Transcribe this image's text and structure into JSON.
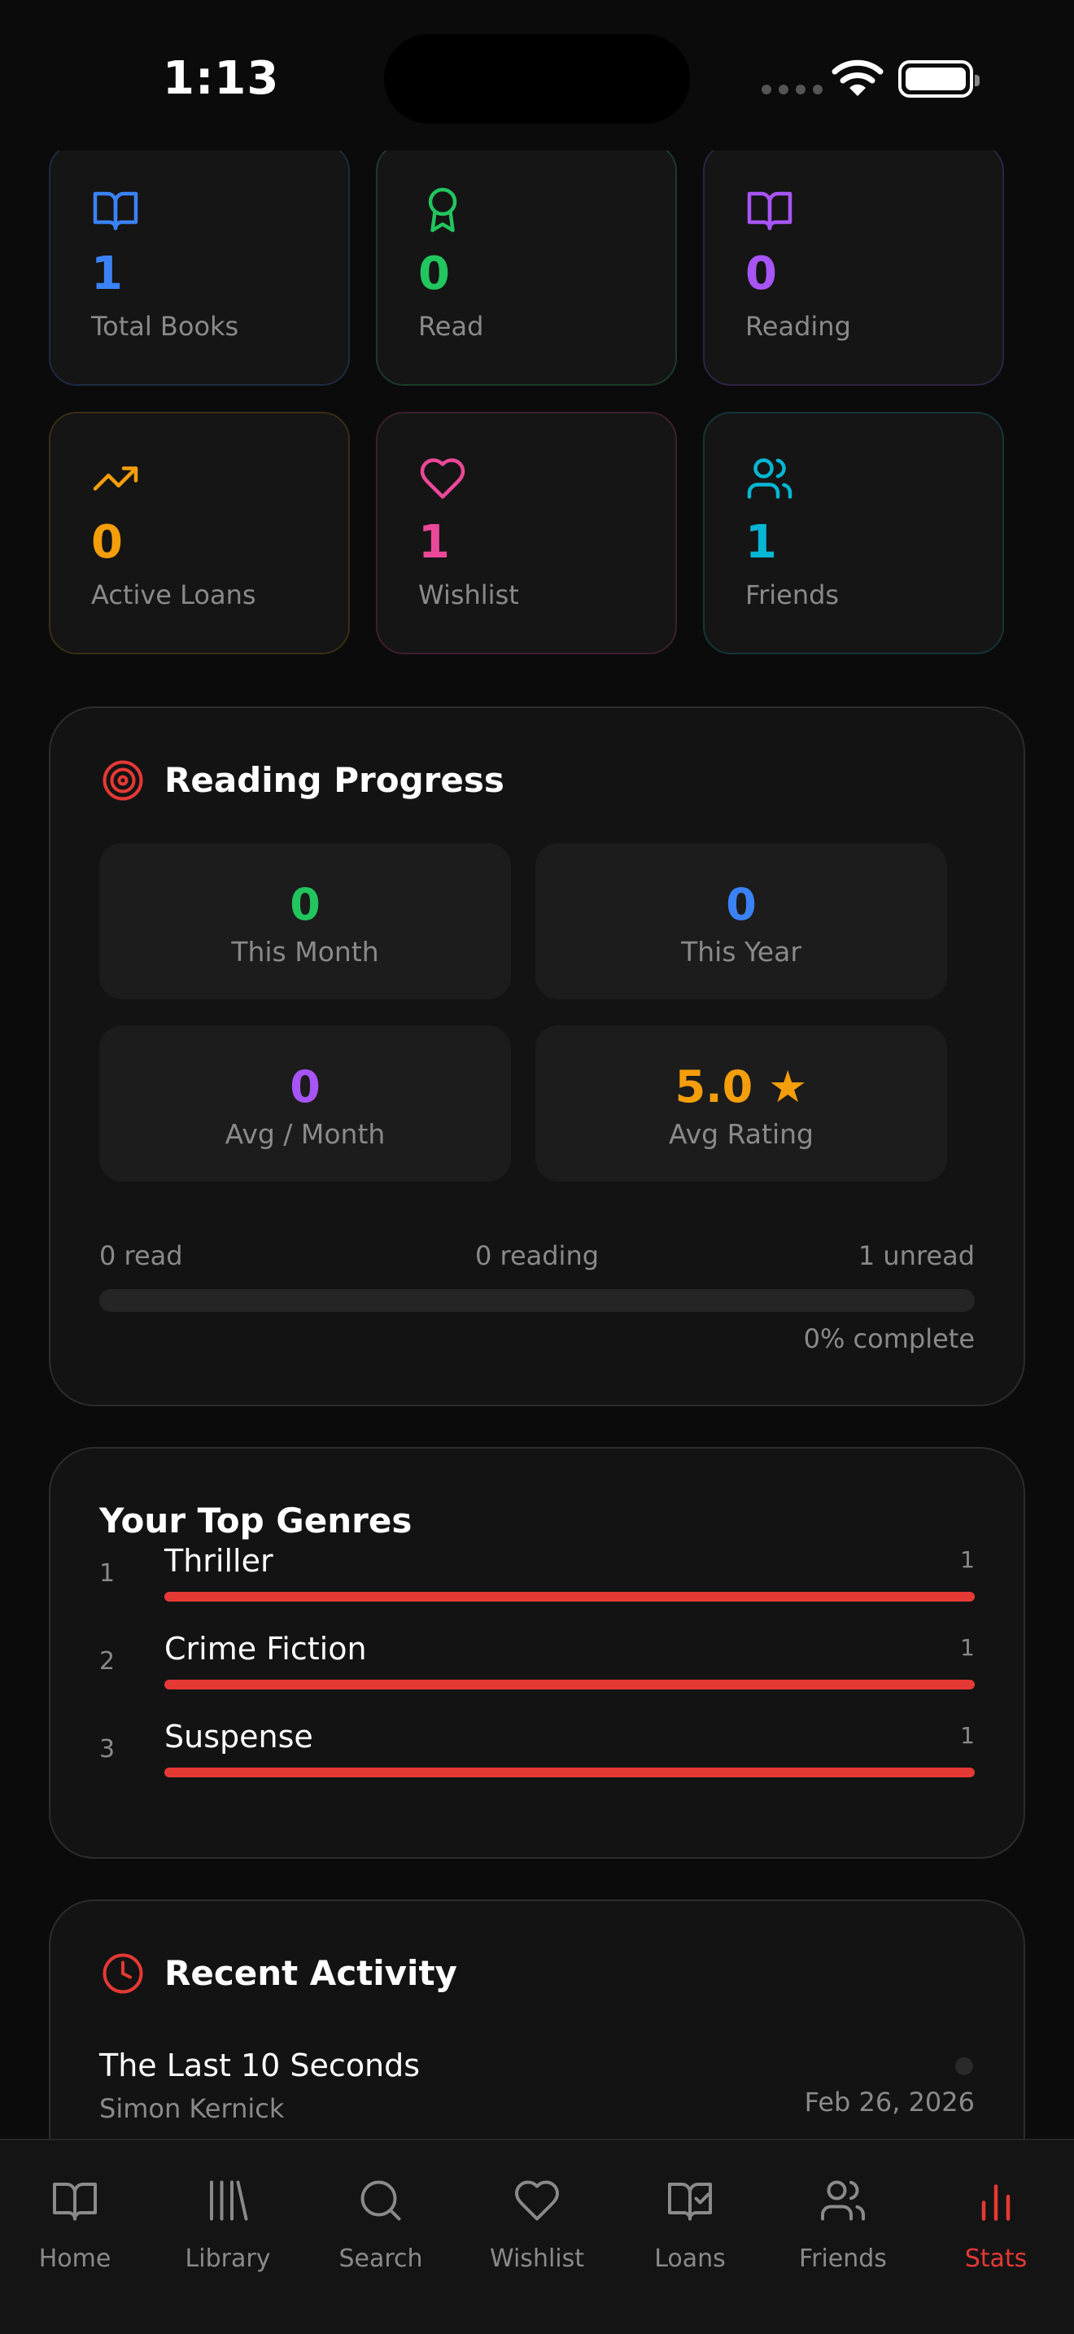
{
  "status_bar": {
    "time": "1:13"
  },
  "stats": [
    {
      "value": "1",
      "label": "Total Books",
      "color": "#3b82f6",
      "icon": "book-open-icon"
    },
    {
      "value": "0",
      "label": "Read",
      "color": "#22c55e",
      "icon": "award-icon"
    },
    {
      "value": "0",
      "label": "Reading",
      "color": "#a855f7",
      "icon": "book-open-icon"
    },
    {
      "value": "0",
      "label": "Active Loans",
      "color": "#f59e0b",
      "icon": "trending-up-icon"
    },
    {
      "value": "1",
      "label": "Wishlist",
      "color": "#ec4899",
      "icon": "heart-icon"
    },
    {
      "value": "1",
      "label": "Friends",
      "color": "#06b6d4",
      "icon": "users-icon"
    }
  ],
  "reading_progress": {
    "title": "Reading Progress",
    "cards": [
      {
        "value": "0",
        "label": "This Month",
        "color": "#22c55e"
      },
      {
        "value": "0",
        "label": "This Year",
        "color": "#3b82f6"
      },
      {
        "value": "0",
        "label": "Avg / Month",
        "color": "#a855f7"
      },
      {
        "value": "5.0 ★",
        "label": "Avg Rating",
        "color": "#f59e0b"
      }
    ],
    "read_label": "0 read",
    "reading_label": "0 reading",
    "unread_label": "1 unread",
    "complete_label": "0% complete",
    "progress_fraction": 0
  },
  "top_genres": {
    "title": "Your Top Genres",
    "items": [
      {
        "rank": "1",
        "name": "Thriller",
        "count": "1",
        "fraction": 1
      },
      {
        "rank": "2",
        "name": "Crime Fiction",
        "count": "1",
        "fraction": 1
      },
      {
        "rank": "3",
        "name": "Suspense",
        "count": "1",
        "fraction": 1
      }
    ]
  },
  "recent_activity": {
    "title": "Recent Activity",
    "items": [
      {
        "title": "The Last 10 Seconds",
        "author": "Simon Kernick",
        "date": "Feb 26, 2026"
      }
    ]
  },
  "tabs": [
    {
      "label": "Home",
      "icon": "book-open-icon",
      "active": false
    },
    {
      "label": "Library",
      "icon": "library-icon",
      "active": false
    },
    {
      "label": "Search",
      "icon": "search-icon",
      "active": false
    },
    {
      "label": "Wishlist",
      "icon": "heart-icon",
      "active": false
    },
    {
      "label": "Loans",
      "icon": "book-check-icon",
      "active": false
    },
    {
      "label": "Friends",
      "icon": "users-icon",
      "active": false
    },
    {
      "label": "Stats",
      "icon": "bar-chart-icon",
      "active": true
    }
  ],
  "accent_color": "#e53935"
}
